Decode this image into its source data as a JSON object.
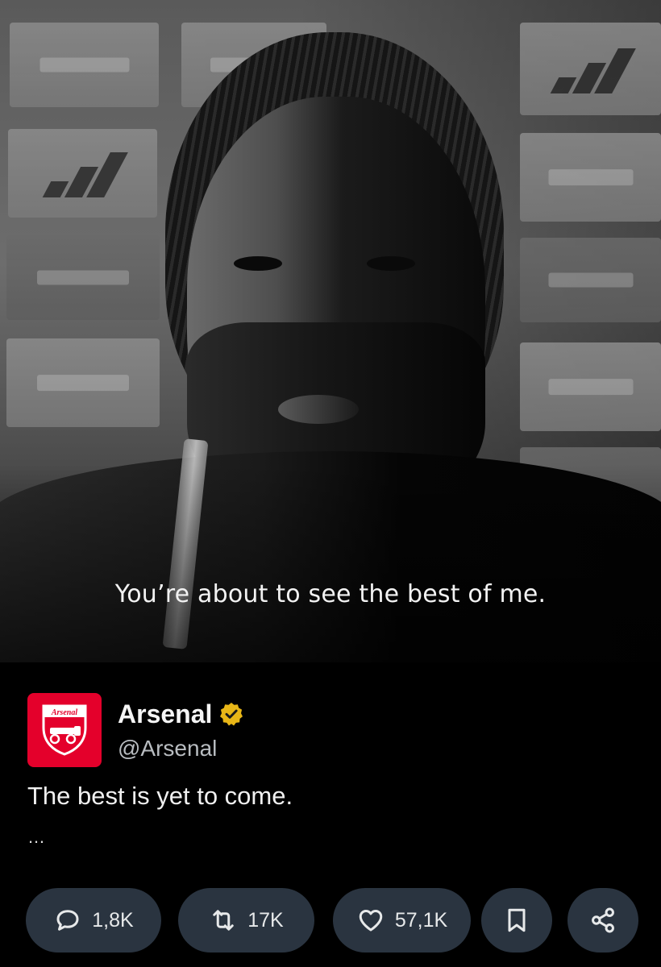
{
  "video": {
    "caption": "You’re about to see the best of me."
  },
  "post": {
    "author": {
      "display_name": "Arsenal",
      "handle": "@Arsenal",
      "verified": true,
      "avatar_text": "Arsenal",
      "avatar_color": "#e4002b",
      "verified_badge_color": "#e8b617"
    },
    "text": "The best is yet to come.",
    "more": "…"
  },
  "actions": {
    "replies": "1,8K",
    "reposts": "17K",
    "likes": "57,1K",
    "bookmark_icon": "bookmark-icon",
    "share_icon": "share-icon"
  },
  "theme": {
    "background": "#000000",
    "pill": "#2a3440",
    "text": "#e7e9ea",
    "muted": "#b8bcc0"
  }
}
